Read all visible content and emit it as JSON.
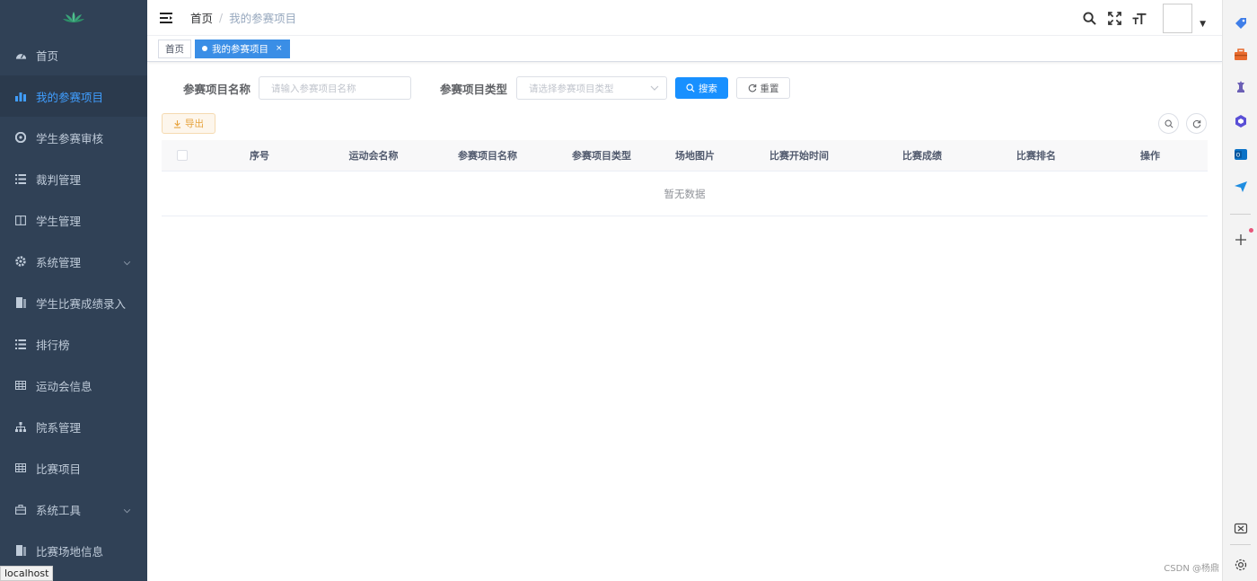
{
  "sidebar": {
    "items": [
      {
        "label": "首页",
        "icon": "dashboard-icon"
      },
      {
        "label": "我的参赛项目",
        "icon": "chart-icon"
      },
      {
        "label": "学生参赛审核",
        "icon": "clipboard-icon"
      },
      {
        "label": "裁判管理",
        "icon": "list-icon"
      },
      {
        "label": "学生管理",
        "icon": "book-icon"
      },
      {
        "label": "系统管理",
        "icon": "gear-icon"
      },
      {
        "label": "学生比赛成绩录入",
        "icon": "edit-icon"
      },
      {
        "label": "排行榜",
        "icon": "list-icon"
      },
      {
        "label": "运动会信息",
        "icon": "table-icon"
      },
      {
        "label": "院系管理",
        "icon": "tree-icon"
      },
      {
        "label": "比赛项目",
        "icon": "table-icon"
      },
      {
        "label": "系统工具",
        "icon": "toolbox-icon"
      },
      {
        "label": "比赛场地信息",
        "icon": "document-icon"
      }
    ],
    "active_index": 1
  },
  "navbar": {
    "breadcrumb_home": "首页",
    "breadcrumb_separator": "/",
    "breadcrumb_current": "我的参赛项目"
  },
  "tags": {
    "home": "首页",
    "current": "我的参赛项目",
    "close": "×"
  },
  "search": {
    "name_label": "参赛项目名称",
    "name_placeholder": "请输入参赛项目名称",
    "type_label": "参赛项目类型",
    "type_placeholder": "请选择参赛项目类型",
    "search_button": "搜索",
    "reset_button": "重置"
  },
  "toolbar": {
    "export_button": "导出"
  },
  "table": {
    "columns": [
      "序号",
      "运动会名称",
      "参赛项目名称",
      "参赛项目类型",
      "场地图片",
      "比赛开始时间",
      "比赛成绩",
      "比赛排名",
      "操作"
    ],
    "empty_text": "暂无数据"
  },
  "status_bar": "localhost",
  "watermark": "CSDN @杨鼎",
  "colors": {
    "sidebar_bg": "#304156",
    "accent": "#1890ff",
    "warning": "#e6a23c"
  }
}
